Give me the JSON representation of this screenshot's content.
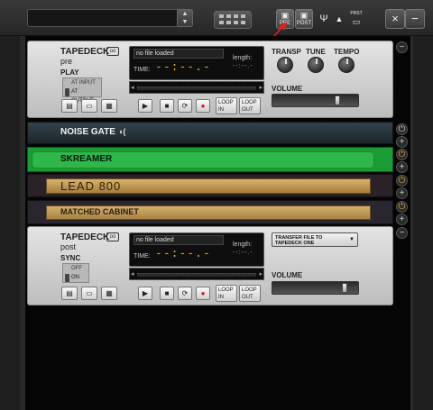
{
  "toolbar": {
    "spin_up": "▲",
    "spin_down": "▼",
    "pre_label": "PRE",
    "pre_icon": "▣",
    "post_label": "POST",
    "post_icon": "▣",
    "tuner_icon": "🎸",
    "metronome_icon": "▲",
    "preset_label": "PRST",
    "preset_icon": "▭",
    "close_icon": "×",
    "minimize_icon": "−"
  },
  "tapedeck_pre": {
    "title": "TAPEDECK",
    "subtitle": "pre",
    "cassette_icon": "oo",
    "mode_label": "PLAY",
    "mode_options": [
      "AT INPUT",
      "AT OUTPUT"
    ],
    "mode_selected": "AT OUTPUT",
    "file_icons": [
      "▤",
      "▭",
      "▦"
    ],
    "file_display": "no file loaded",
    "time_label": "TIME:",
    "time_value": "--:--.-",
    "length_label": "length:",
    "length_value": "--:--.-",
    "scrub_left": "◂",
    "scrub_right": "▸",
    "transport": [
      "▶",
      "■",
      "⟳",
      "●"
    ],
    "loop_in": "LOOP IN",
    "loop_out": "LOOP OUT",
    "knobs": [
      "TRANSP",
      "TUNE",
      "TEMPO"
    ],
    "volume_label": "VOLUME",
    "volume_level": 0.78
  },
  "noise_gate": {
    "label": "NOISE GATE",
    "icon": "◖("
  },
  "skreamer": {
    "label": "SKREAMER",
    "color": "#2fb84a"
  },
  "lead800": {
    "label": "LEAD 800",
    "color": "#c9a055"
  },
  "matched_cabinet": {
    "label": "MATCHED CABINET",
    "color": "#c8a158"
  },
  "tapedeck_post": {
    "title": "TAPEDECK",
    "subtitle": "post",
    "cassette_icon": "oo",
    "mode_label": "SYNC",
    "mode_options": [
      "OFF",
      "ON"
    ],
    "mode_selected": "ON",
    "file_icons": [
      "▤",
      "▭",
      "▦"
    ],
    "file_display": "no file loaded",
    "time_label": "TIME:",
    "time_value": "--:--.-",
    "length_label": "length:",
    "length_value": "--:--.-",
    "scrub_left": "◂",
    "scrub_right": "▸",
    "transport": [
      "▶",
      "■",
      "⟳",
      "●"
    ],
    "loop_in": "LOOP IN",
    "loop_out": "LOOP OUT",
    "transfer_dropdown": "TRANSFER FILE TO TAPEDECK ONE",
    "dropdown_arrow": "▼",
    "volume_label": "VOLUME",
    "volume_level": 0.88
  },
  "rack_side": {
    "power_icon": "⏻",
    "add_icon": "+"
  },
  "colors": {
    "accent_red": "#e02020",
    "display_amber": "#e8a020"
  }
}
